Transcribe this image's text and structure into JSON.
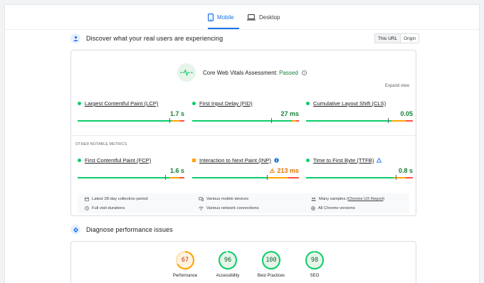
{
  "tabs": [
    {
      "label": "Mobile",
      "active": true
    },
    {
      "label": "Desktop",
      "active": false
    }
  ],
  "discover": {
    "title": "Discover what your real users are experiencing",
    "toggle": [
      "This URL",
      "Origin"
    ],
    "assessment_label": "Core Web Vitals Assessment:",
    "assessment_status": "Passed",
    "expand": "Expand view"
  },
  "core_metrics": [
    {
      "label": "Largest Contentful Paint (LCP)",
      "value": "1.7 s",
      "status": "good"
    },
    {
      "label": "First Input Delay (FID)",
      "value": "27 ms",
      "status": "good"
    },
    {
      "label": "Cumulative Layout Shift (CLS)",
      "value": "0.05",
      "status": "good"
    }
  ],
  "other_label": "OTHER NOTABLE METRICS",
  "other_metrics": [
    {
      "label": "First Contentful Paint (FCP)",
      "value": "1.6 s",
      "status": "good"
    },
    {
      "label": "Interaction to Next Paint (INP)",
      "value": "213 ms",
      "status": "needs-improvement",
      "badge": "info-icon"
    },
    {
      "label": "Time to First Byte (TTFB)",
      "value": "0.8 s",
      "status": "good",
      "badge": "experimental-icon"
    }
  ],
  "footer": {
    "period": "Latest 28-day collection period",
    "devices": "Various mobile devices",
    "samples_prefix": "Many samples (",
    "samples_link": "Chrome UX Report",
    "samples_suffix": ")",
    "durations": "Full visit durations",
    "connections": "Various network connections",
    "versions": "All Chrome versions"
  },
  "diagnose": {
    "title": "Diagnose performance issues"
  },
  "scores": [
    {
      "label": "Performance",
      "value": 67,
      "color": "#ffa400",
      "track": "#fff3e0"
    },
    {
      "label": "Accessibility",
      "value": 96,
      "color": "#0cce6b",
      "track": "#e6f4ea"
    },
    {
      "label": "Best Practices",
      "value": 100,
      "color": "#0cce6b",
      "track": "#e6f4ea"
    },
    {
      "label": "SEO",
      "value": 98,
      "color": "#0cce6b",
      "track": "#e6f4ea"
    }
  ],
  "colors": {
    "accent": "#1a73e8",
    "good": "#188038",
    "warn": "#e37400",
    "good_bar": "#0cce6b",
    "warn_bar": "#ffa400",
    "poor_bar": "#ff4e42"
  }
}
